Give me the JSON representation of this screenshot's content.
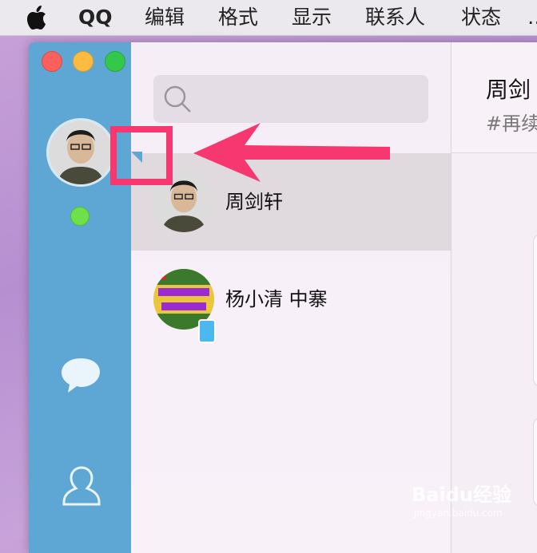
{
  "menubar": {
    "app_name": "QQ",
    "items": [
      "编辑",
      "格式",
      "显示",
      "联系人",
      "状态"
    ]
  },
  "search": {
    "placeholder": ""
  },
  "contacts": [
    {
      "name": "周剑轩",
      "selected": true
    },
    {
      "name": "杨小清 中寨",
      "selected": false,
      "device": "phone-icon"
    }
  ],
  "chat": {
    "title": "周剑",
    "subtitle": "#再续"
  },
  "watermark": {
    "text": "Baidu经验",
    "sub": "jingyan.baidu.com"
  },
  "colors": {
    "sidebar": "#5ea6d4",
    "annotation": "#f7376f",
    "online": "#6fe04a"
  }
}
